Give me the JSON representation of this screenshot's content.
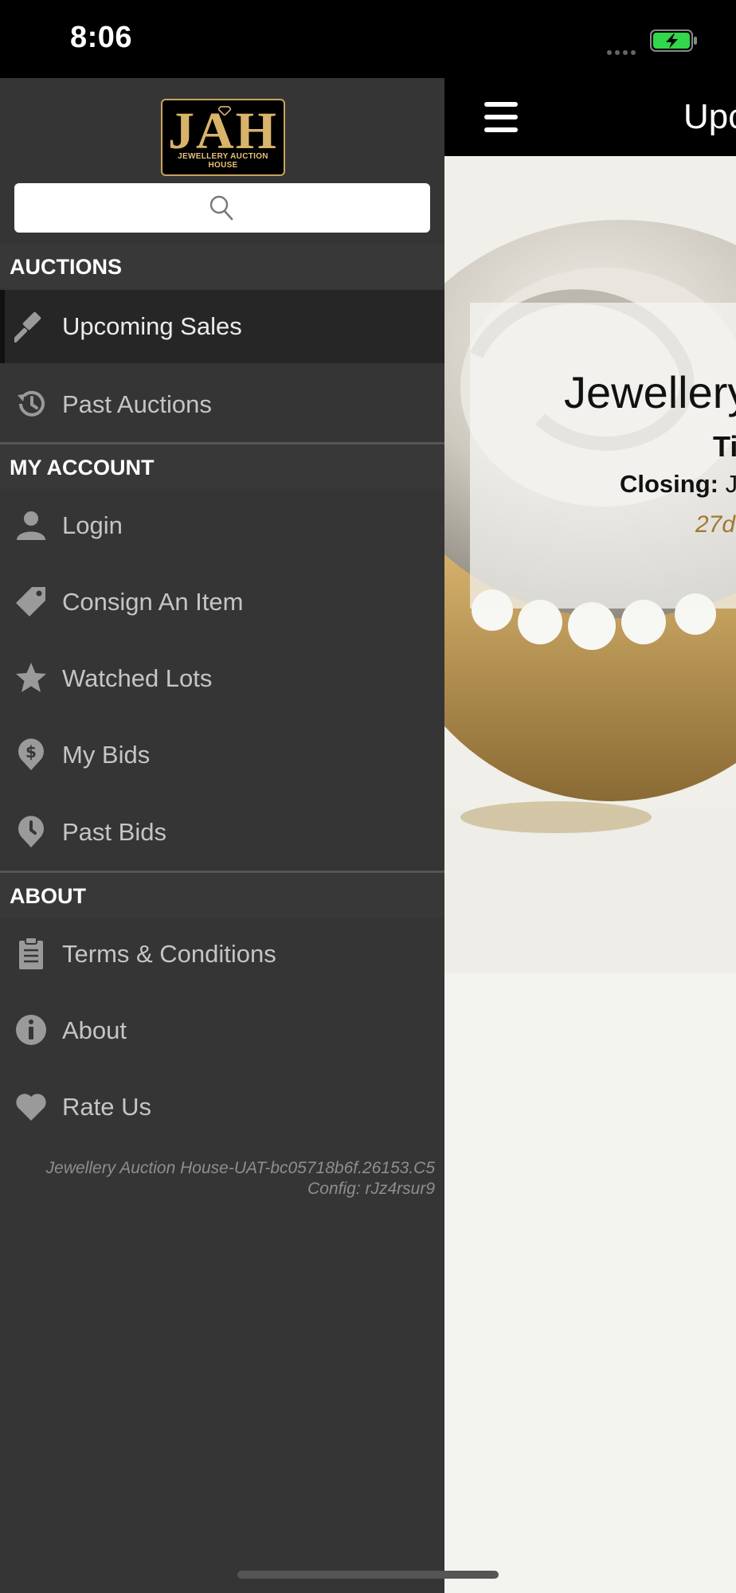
{
  "status_bar": {
    "time": "8:06"
  },
  "content": {
    "nav_title": "Upcoming Sales",
    "sale_card": {
      "title": "Jewellery",
      "subtitle": "Ti",
      "closing_label": "Closing:",
      "closing_value": "Ju",
      "countdown": "27d"
    }
  },
  "drawer": {
    "logo": {
      "text": "JAH",
      "subtitle": "JEWELLERY AUCTION HOUSE"
    },
    "search": {
      "placeholder": ""
    },
    "sections": [
      {
        "header": "AUCTIONS",
        "items": [
          {
            "label": "Upcoming Sales",
            "icon": "gavel-icon",
            "active": true
          },
          {
            "label": "Past Auctions",
            "icon": "history-icon",
            "active": false
          }
        ]
      },
      {
        "header": "MY ACCOUNT",
        "items": [
          {
            "label": "Login",
            "icon": "user-icon"
          },
          {
            "label": "Consign An Item",
            "icon": "tag-icon"
          },
          {
            "label": "Watched Lots",
            "icon": "star-icon"
          },
          {
            "label": "My Bids",
            "icon": "dollar-pin-icon"
          },
          {
            "label": "Past Bids",
            "icon": "clock-pin-icon"
          }
        ]
      },
      {
        "header": "ABOUT",
        "items": [
          {
            "label": "Terms & Conditions",
            "icon": "clipboard-icon"
          },
          {
            "label": "About",
            "icon": "info-icon"
          },
          {
            "label": "Rate Us",
            "icon": "heart-icon"
          }
        ]
      }
    ],
    "version": {
      "build": "Jewellery Auction House-UAT-bc05718b6f.26153.C5",
      "config": "Config: rJz4rsur9"
    }
  },
  "colors": {
    "drawer_bg": "#353535",
    "header_bg": "#383838",
    "active_bg": "#262626",
    "gold_accent": "#d8b36a",
    "countdown_text": "#a07830"
  }
}
